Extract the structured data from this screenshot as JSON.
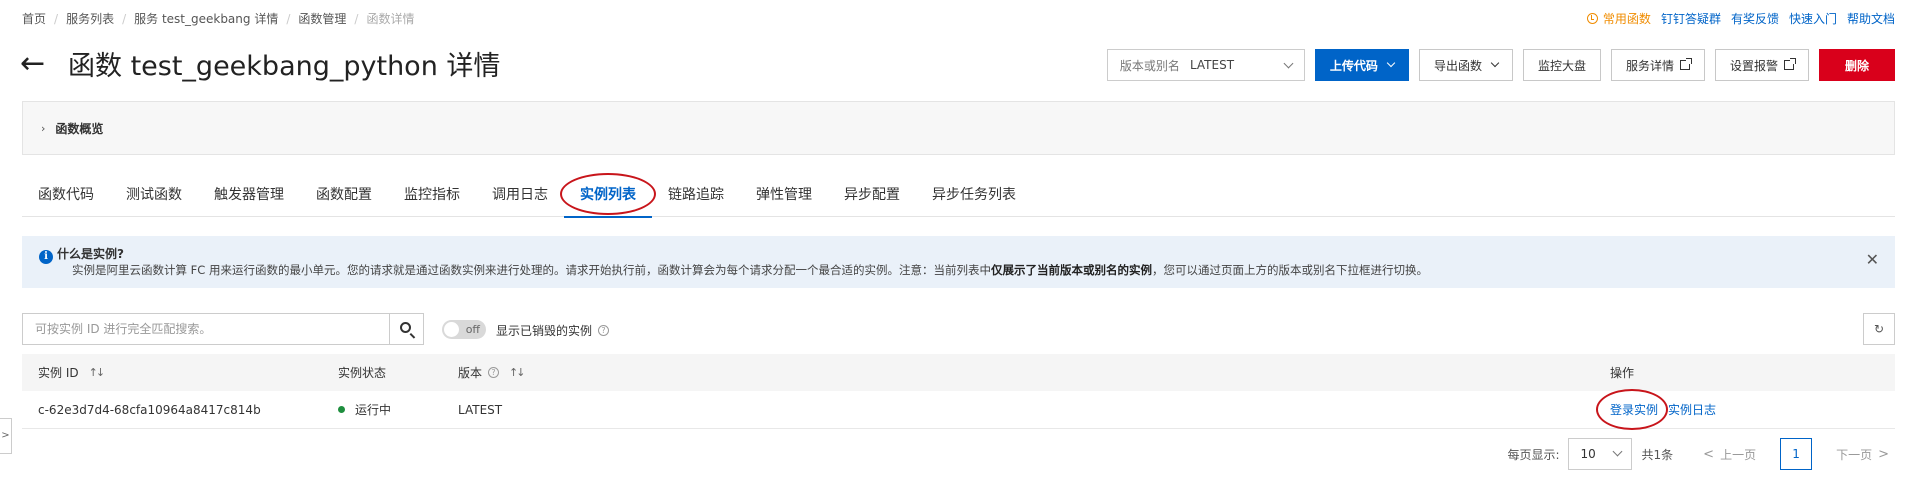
{
  "breadcrumb": {
    "items": [
      "首页",
      "服务列表",
      "服务 test_geekbang 详情",
      "函数管理",
      "函数详情"
    ],
    "sep": "/"
  },
  "toplinks": {
    "common": "常用函数",
    "dingtalk": "钉钉答疑群",
    "feedback": "有奖反馈",
    "quickstart": "快速入门",
    "help": "帮助文档"
  },
  "header": {
    "back": "←",
    "title": "函数 test_geekbang_python 详情",
    "version_label": "版本或别名",
    "version_value": "LATEST",
    "upload": "上传代码",
    "export": "导出函数",
    "monitor": "监控大盘",
    "service_detail": "服务详情",
    "alarm": "设置报警",
    "delete": "删除"
  },
  "overview": {
    "arrow": "›",
    "label": "函数概览"
  },
  "tabs": [
    "函数代码",
    "测试函数",
    "触发器管理",
    "函数配置",
    "监控指标",
    "调用日志",
    "实例列表",
    "链路追踪",
    "弹性管理",
    "异步配置",
    "异步任务列表"
  ],
  "active_tab": 6,
  "info": {
    "icon": "i",
    "title": "什么是实例?",
    "text_before": "实例是阿里云函数计算 FC 用来运行函数的最小单元。您的请求就是通过函数实例来进行处理的。请求开始执行前，函数计算会为每个请求分配一个最合适的实例。注意：当前列表中",
    "text_bold": "仅展示了当前版本或别名的实例",
    "text_after": "，您可以通过页面上方的版本或别名下拉框进行切换。",
    "close": "✕"
  },
  "search": {
    "placeholder": "可按实例 ID 进行完全匹配搜索。",
    "toggle_text": "off",
    "toggle_label": "显示已销毁的实例",
    "help": "?",
    "refresh": "↻"
  },
  "table": {
    "headers": {
      "id": "实例 ID",
      "status": "实例状态",
      "version": "版本",
      "actions": "操作",
      "sort": "↑↓",
      "help": "?"
    },
    "rows": [
      {
        "id": "c-62e3d7d4-68cfa10964a8417c814b",
        "status": "运行中",
        "version": "LATEST",
        "action_login": "登录实例",
        "action_log": "实例日志"
      }
    ]
  },
  "pagination": {
    "per_page_label": "每页显示:",
    "per_page": "10",
    "total": "共1条",
    "prev": "上一页",
    "page": "1",
    "next": "下一页",
    "lt": "<",
    "gt": ">"
  },
  "side_handle": ">",
  "colors": {
    "primary": "#0064c8",
    "danger": "#d9001b",
    "warning": "#f08c00",
    "running": "#1e8e3e",
    "annotation": "#c8151b"
  }
}
